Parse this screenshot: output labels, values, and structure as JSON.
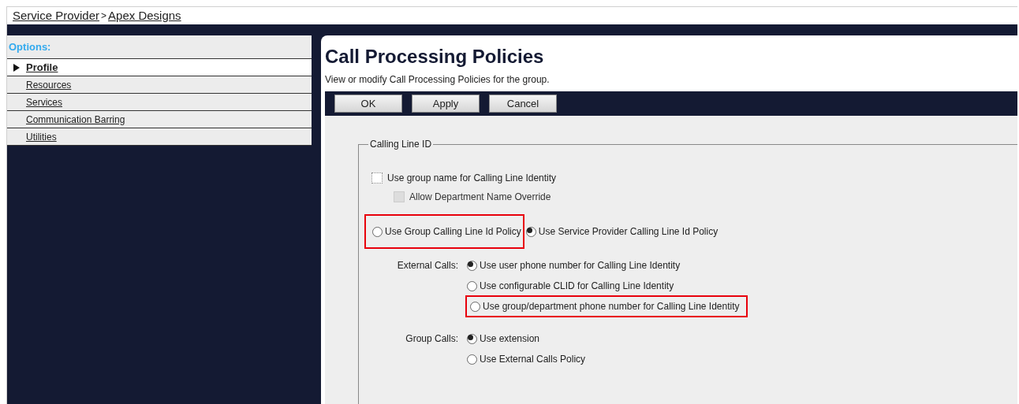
{
  "breadcrumb": [
    {
      "label": "Service Provider"
    },
    {
      "separator": ">"
    },
    {
      "label": "Apex Designs"
    }
  ],
  "sidebar": {
    "heading": "Options:",
    "items": [
      {
        "label": "Profile",
        "selected": true
      },
      {
        "label": "Resources",
        "selected": false
      },
      {
        "label": "Services",
        "selected": false
      },
      {
        "label": "Communication Barring",
        "selected": false
      },
      {
        "label": "Utilities",
        "selected": false
      }
    ]
  },
  "page": {
    "title": "Call Processing Policies",
    "description": "View or modify Call Processing Policies for the group."
  },
  "toolbar": {
    "buttons": [
      "OK",
      "Apply",
      "Cancel"
    ]
  },
  "fieldset": {
    "legend": "Calling Line ID",
    "checkboxes": [
      {
        "label": "Use group name for Calling Line Identity",
        "checked": false,
        "disabled": false
      },
      {
        "label": "Allow Department Name Override",
        "checked": false,
        "disabled": true
      }
    ],
    "policy": [
      {
        "label": "Use Group Calling Line Id Policy",
        "selected": false,
        "highlighted": true
      },
      {
        "label": "Use Service Provider Calling Line Id Policy",
        "selected": true,
        "highlighted": false
      }
    ],
    "groups": [
      {
        "label": "External Calls:",
        "options": [
          {
            "label": "Use user phone number for Calling Line Identity",
            "selected": true,
            "highlighted": false
          },
          {
            "label": "Use configurable CLID for Calling Line Identity",
            "selected": false,
            "highlighted": false
          },
          {
            "label": "Use group/department phone number for Calling Line Identity",
            "selected": false,
            "highlighted": true
          }
        ]
      },
      {
        "label": "Group Calls:",
        "options": [
          {
            "label": "Use extension",
            "selected": true,
            "highlighted": false
          },
          {
            "label": "Use External Calls Policy",
            "selected": false,
            "highlighted": false
          }
        ]
      }
    ]
  }
}
